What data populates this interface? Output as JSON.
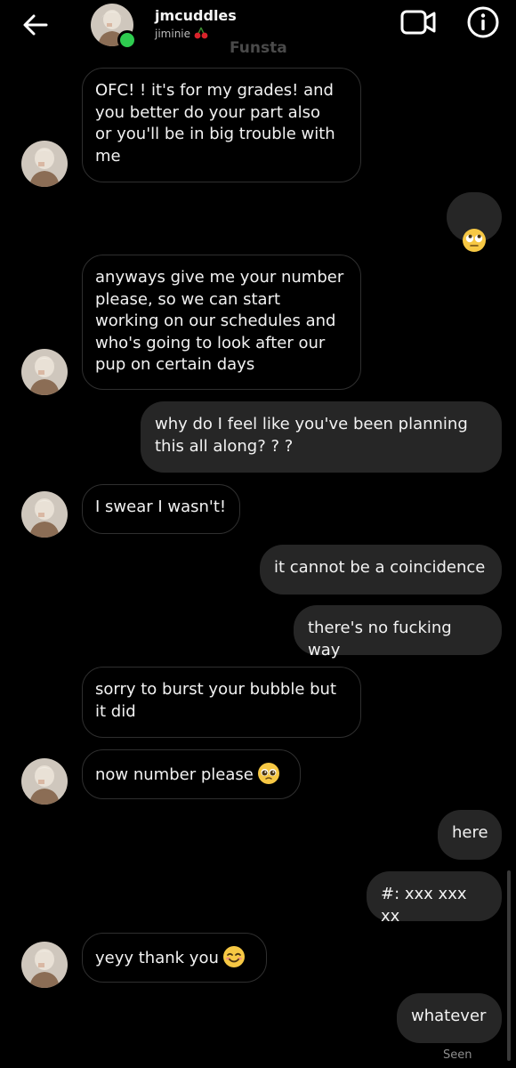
{
  "header": {
    "username": "jmcuddles",
    "display_name": "jiminie",
    "label": "Funsta",
    "back_icon": "arrow-left-icon",
    "video_icon": "video-camera-icon",
    "info_icon": "info-icon",
    "online_color": "#2ecc4f"
  },
  "messages": [
    {
      "from": "them",
      "text": "OFC! !  it's for my grades!  and\nyou better do your part also\nor you'll be in big trouble with\nme"
    },
    {
      "from": "me",
      "emoji": "rolling-eyes-emoji"
    },
    {
      "from": "them",
      "text": "anyways give me your number\nplease, so we can start\nworking on our schedules and\nwho's going to look after our\npup on certain days"
    },
    {
      "from": "me",
      "text": "why do I feel like you've been planning\nthis all along? ? ?"
    },
    {
      "from": "them",
      "text": "I swear I wasn't!"
    },
    {
      "from": "me",
      "text": "it cannot be a coincidence"
    },
    {
      "from": "me",
      "text": "there's no fucking way"
    },
    {
      "from": "them",
      "text": "sorry to burst your bubble but\nit did"
    },
    {
      "from": "them",
      "text": "now number please",
      "emoji": "pleading-face-emoji"
    },
    {
      "from": "me",
      "text": "here"
    },
    {
      "from": "me",
      "text": "#: xxx xxx xx"
    },
    {
      "from": "them",
      "text": "yeyy thank you",
      "emoji": "smiling-face-emoji"
    },
    {
      "from": "me",
      "text": "whatever"
    }
  ],
  "status": {
    "seen": "Seen"
  }
}
